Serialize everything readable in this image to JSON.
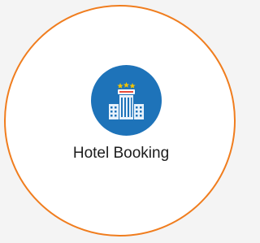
{
  "tile": {
    "label": "Hotel Booking",
    "icon": "hotel-building-icon",
    "border_color": "#f07d1e",
    "icon_bg_color": "#1e73b9",
    "background_color": "#ffffff"
  }
}
